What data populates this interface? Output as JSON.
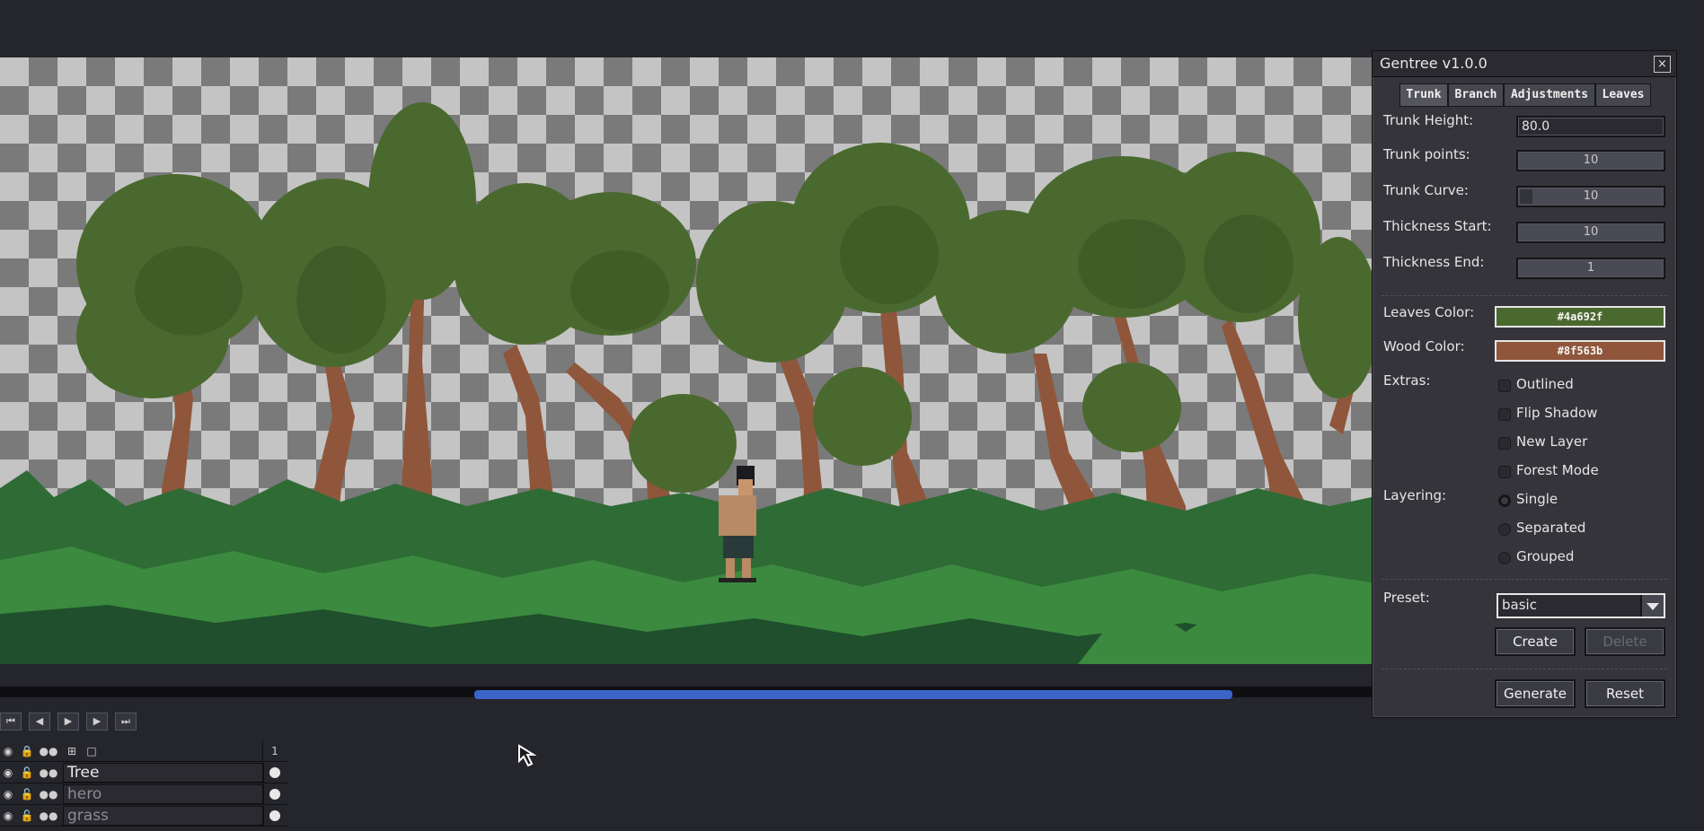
{
  "dialog": {
    "title": "Gentree v1.0.0",
    "close": "×",
    "tabs": [
      "Trunk",
      "Branch",
      "Adjustments",
      "Leaves"
    ],
    "fields": {
      "trunk_height": {
        "label": "Trunk Height:",
        "value": "80.0"
      },
      "trunk_points": {
        "label": "Trunk points:",
        "value": "10"
      },
      "trunk_curve": {
        "label": "Trunk Curve:",
        "value": "10"
      },
      "thickness_start": {
        "label": "Thickness Start:",
        "value": "10"
      },
      "thickness_end": {
        "label": "Thickness End:",
        "value": "1"
      }
    },
    "colors": {
      "leaves": {
        "label": "Leaves Color:",
        "value": "#4a692f"
      },
      "wood": {
        "label": "Wood Color:",
        "value": "#8f563b"
      }
    },
    "extras": {
      "label": "Extras:",
      "options": [
        "Outlined",
        "Flip Shadow",
        "New Layer",
        "Forest Mode"
      ]
    },
    "layering": {
      "label": "Layering:",
      "options": [
        "Single",
        "Separated",
        "Grouped"
      ],
      "selected": "Single"
    },
    "preset": {
      "label": "Preset:",
      "value": "basic"
    },
    "buttons": {
      "create": "Create",
      "delete": "Delete",
      "generate": "Generate",
      "reset": "Reset"
    }
  },
  "timeline": {
    "frame_number": "1",
    "layers": [
      {
        "name": "Tree",
        "active": true
      },
      {
        "name": "hero",
        "active": false
      },
      {
        "name": "grass",
        "active": false
      }
    ]
  },
  "accent_colors": {
    "progress": "#3c64c8",
    "leaves": "#4a692f",
    "wood": "#8f563b"
  }
}
